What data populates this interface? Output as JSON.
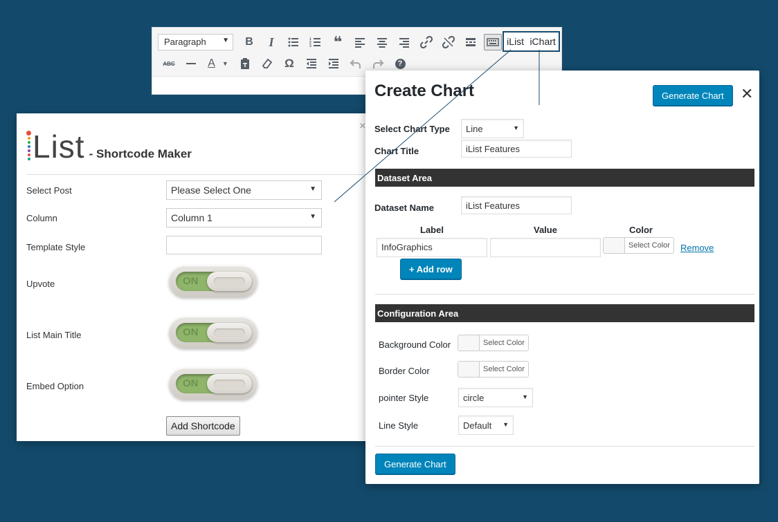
{
  "editor": {
    "format_select": "Paragraph",
    "plugin_buttons": [
      "iList",
      "iChart"
    ],
    "row1_icons": [
      "bold-icon",
      "italic-icon",
      "bullet-list-icon",
      "numbered-list-icon",
      "blockquote-icon",
      "align-left-icon",
      "align-center-icon",
      "align-right-icon",
      "link-icon",
      "unlink-icon",
      "read-more-icon",
      "toolbar-toggle-icon"
    ],
    "row2_icons": [
      "strikethrough-icon",
      "horizontal-line-icon",
      "text-color-icon",
      "paste-text-icon",
      "clear-formatting-icon",
      "special-character-icon",
      "outdent-icon",
      "indent-icon",
      "undo-icon",
      "redo-icon",
      "help-icon"
    ],
    "row1_glyphs": {
      "bold": "B",
      "italic": "I",
      "quote": "❝"
    },
    "row2_glyphs": {
      "strike": "ABC",
      "omega": "Ω",
      "help": "?",
      "text_color": "A"
    }
  },
  "ilist": {
    "logo": "List",
    "subtitle": "- Shortcode Maker",
    "close": "×",
    "fields": [
      {
        "label": "Select Post",
        "value": "Please Select One"
      },
      {
        "label": "Column",
        "value": "Column 1"
      },
      {
        "label": "Template Style",
        "value": ""
      },
      {
        "label": "Upvote",
        "value": "ON"
      },
      {
        "label": "List Main Title",
        "value": "ON"
      },
      {
        "label": "Embed Option",
        "value": "ON"
      }
    ],
    "add_button": "Add Shortcode",
    "logo_dot_colors": [
      "#e74c3c",
      "#f39c12",
      "#27ae60",
      "#2980b9",
      "#8e44ad",
      "#e74c3c",
      "#16a085"
    ]
  },
  "chart": {
    "title": "Create Chart",
    "generate_label": "Generate Chart",
    "close": "✕",
    "chart_type_label": "Select Chart Type",
    "chart_type_value": "Line",
    "chart_title_label": "Chart Title",
    "chart_title_value": "iList Features",
    "dataset_section": "Dataset Area",
    "dataset_name_label": "Dataset Name",
    "dataset_name_value": "iList Features",
    "columns": {
      "label": "Label",
      "value": "Value",
      "color": "Color"
    },
    "row": {
      "label": "InfoGraphics",
      "value": "",
      "color_btn": "Select Color",
      "remove": "Remove"
    },
    "add_row": "+ Add row",
    "config_section": "Configuration Area",
    "bg_color_label": "Background Color",
    "border_color_label": "Border Color",
    "select_color": "Select Color",
    "pointer_style_label": "pointer Style",
    "pointer_style_value": "circle",
    "line_style_label": "Line Style",
    "line_style_value": "Default",
    "accent_color": "#0085ba"
  }
}
